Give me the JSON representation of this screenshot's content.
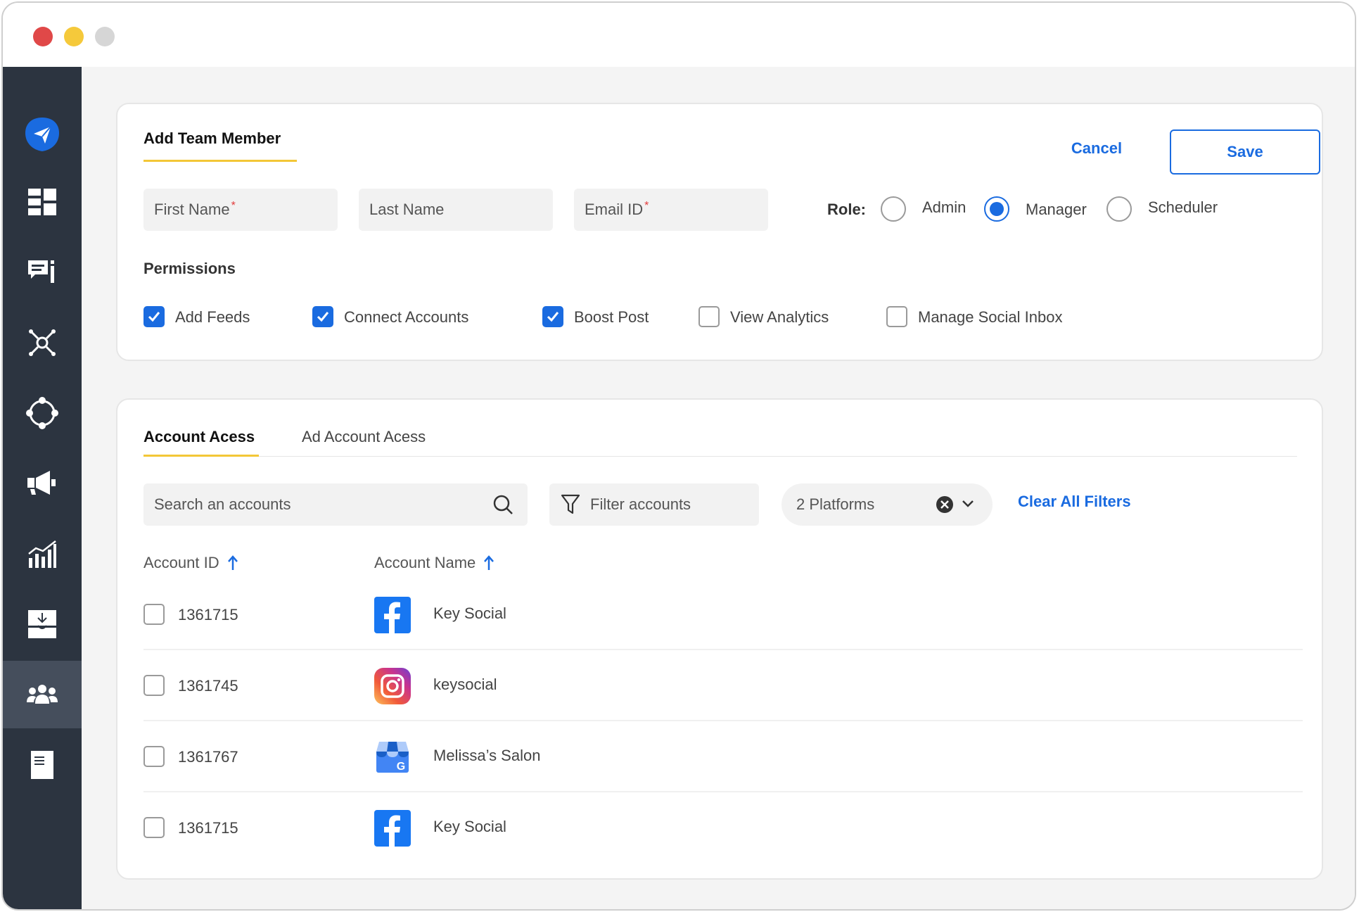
{
  "header": {
    "title": "Add Team Member",
    "cancel_label": "Cancel",
    "save_label": "Save"
  },
  "form": {
    "first_name_placeholder": "First Name",
    "last_name_placeholder": "Last Name",
    "email_placeholder": "Email ID",
    "required_mark": "*"
  },
  "role": {
    "label": "Role:",
    "options": [
      "Admin",
      "Manager",
      "Scheduler"
    ],
    "selected": "Manager"
  },
  "permissions": {
    "label": "Permissions",
    "items": [
      {
        "label": "Add Feeds",
        "checked": true
      },
      {
        "label": "Connect Accounts",
        "checked": true
      },
      {
        "label": "Boost Post",
        "checked": true
      },
      {
        "label": "View Analytics",
        "checked": false
      },
      {
        "label": "Manage Social Inbox",
        "checked": false
      }
    ]
  },
  "tabs": {
    "active": "Account Acess",
    "inactive": "Ad Account Acess"
  },
  "filters": {
    "search_placeholder": "Search an accounts",
    "filter_placeholder": "Filter accounts",
    "platforms_value": "2 Platforms",
    "clear_all_label": "Clear All Filters"
  },
  "table": {
    "columns": [
      "Account ID",
      "Account Name"
    ],
    "rows": [
      {
        "id": "1361715",
        "name": "Key Social",
        "platform": "facebook-icon"
      },
      {
        "id": "1361745",
        "name": "keysocial",
        "platform": "instagram-icon"
      },
      {
        "id": "1361767",
        "name": "Melissa’s Salon",
        "platform": "google-business-icon"
      },
      {
        "id": "1361715",
        "name": "Key Social",
        "platform": "facebook-icon"
      }
    ]
  },
  "colors": {
    "accent": "#1a6be0",
    "sidebar": "#2c3440",
    "sidebar_active": "#454e5c",
    "underline": "#f3c737",
    "facebook": "#1877f2"
  }
}
